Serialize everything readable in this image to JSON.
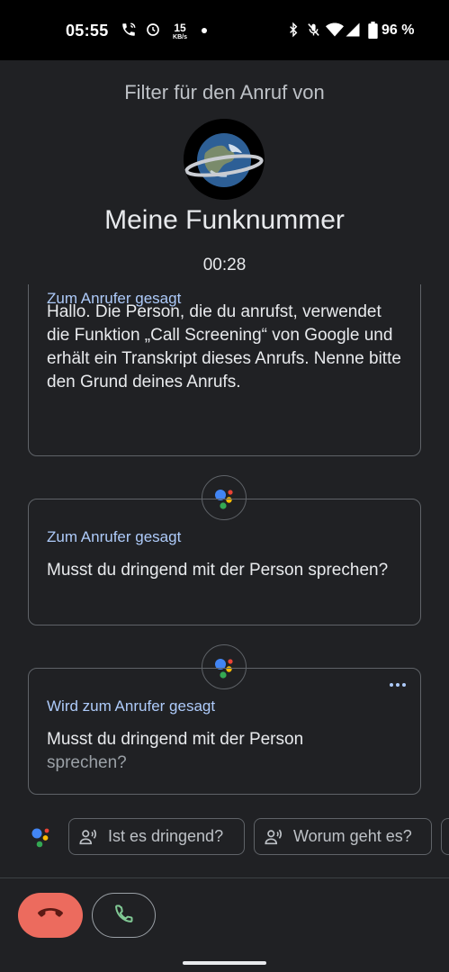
{
  "status_bar": {
    "time": "05:55",
    "net_speed_value": "15",
    "net_speed_unit": "KB/s",
    "battery": "96 %"
  },
  "header": {
    "subtitle": "Filter für den Anruf von",
    "caller_name": "Meine Funknummer",
    "timer": "00:28"
  },
  "transcript": [
    {
      "label": "Zum Anrufer gesagt",
      "text": "Hallo. Die Person, die du anrufst, verwendet die Funktion „Call Screening“ von Google und erhält ein Transkript dieses Anrufs. Nenne bitte den Grund deines Anrufs."
    },
    {
      "label": "Zum Anrufer gesagt",
      "text": "Musst du dringend mit der Person sprechen?"
    },
    {
      "label": "Wird zum Anrufer gesagt",
      "text_spoken": "Musst du dringend mit der Person",
      "text_pending": "sprechen?"
    }
  ],
  "quick_replies": [
    "Ist es dringend?",
    "Worum geht es?"
  ],
  "icons": {
    "assistant_dots": [
      "#4285f4",
      "#ea4335",
      "#fbbc04",
      "#34a853"
    ],
    "end_call_color": "#ec6b5e",
    "answer_color": "#81c995"
  }
}
